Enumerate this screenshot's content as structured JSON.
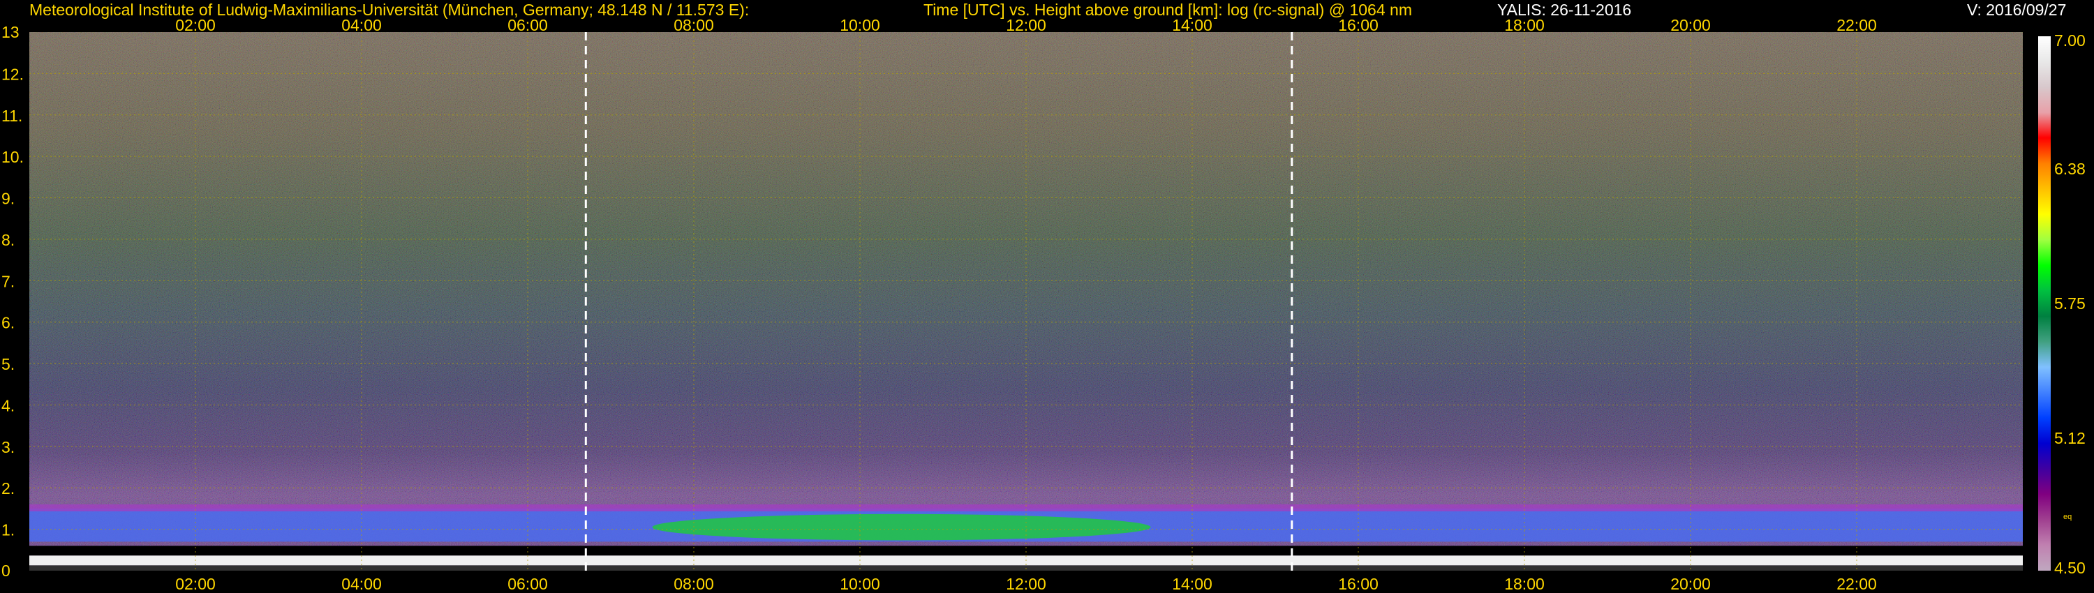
{
  "header": {
    "institute": "Meteorological Institute of Ludwig-Maximilians-Universität (München, Germany; 48.148 N / 11.573 E):",
    "axes_title": "Time [UTC] vs. Height above ground [km]: log (rc-signal) @ 1064 nm",
    "instrument": "YALIS: 26-11-2016",
    "version": "V: 2016/09/27"
  },
  "colors": {
    "text": "#ffd700",
    "background": "#000000",
    "grid": "#b4a000",
    "marker": "#ffffff"
  },
  "chart_data": {
    "type": "heatmap",
    "x_axis": {
      "quantity": "Time [UTC]",
      "range": [
        "00:00",
        "24:00"
      ],
      "tick_labels": [
        "02:00",
        "04:00",
        "06:00",
        "08:00",
        "10:00",
        "12:00",
        "14:00",
        "16:00",
        "18:00",
        "20:00",
        "22:00"
      ],
      "positions": "top and bottom"
    },
    "y_axis": {
      "quantity": "Height above ground [km]",
      "range": [
        0,
        13
      ],
      "tick_labels": [
        "0",
        "1.",
        "2.",
        "3.",
        "4.",
        "5.",
        "6.",
        "7.",
        "8.",
        "9.",
        "10.",
        "11.",
        "12.",
        "13"
      ]
    },
    "colorbar": {
      "quantity": "log (rc-signal) @ 1064 nm",
      "range": [
        4.5,
        7.0
      ],
      "tick_labels": [
        "7.00",
        "6.38",
        "5.75",
        "5.12",
        "4.50"
      ],
      "extra_label": "eq",
      "palette_top_to_bottom": [
        "#ffffff",
        "#e8e8e8",
        "#d8c8cc",
        "#e8a0a8",
        "#ff0000",
        "#ff8000",
        "#ffc000",
        "#ffff00",
        "#a0ff40",
        "#00ff00",
        "#00c040",
        "#008040",
        "#40a080",
        "#80c0ff",
        "#4080ff",
        "#0040ff",
        "#0000d0",
        "#4000a0",
        "#800080",
        "#a04090",
        "#c080b0",
        "#c0a8c0"
      ]
    },
    "markers": [
      {
        "type": "dashed vertical line",
        "time": "06:42"
      },
      {
        "type": "dashed vertical line",
        "time": "15:12"
      }
    ],
    "grid": true,
    "features": [
      {
        "description": "boundary layer top aerosol band",
        "height_km": [
          0.7,
          1.5
        ],
        "time_range": [
          "00:00",
          "24:00"
        ],
        "value_approx": 5.3
      },
      {
        "description": "enhanced signal layer",
        "height_km": [
          0.8,
          1.3
        ],
        "time_range": [
          "07:30",
          "13:30"
        ],
        "value_approx": 5.8
      },
      {
        "description": "near-surface saturated layer",
        "height_km": [
          0.0,
          0.6
        ],
        "time_range": [
          "00:00",
          "24:00"
        ],
        "value_approx": 7.0
      }
    ]
  }
}
